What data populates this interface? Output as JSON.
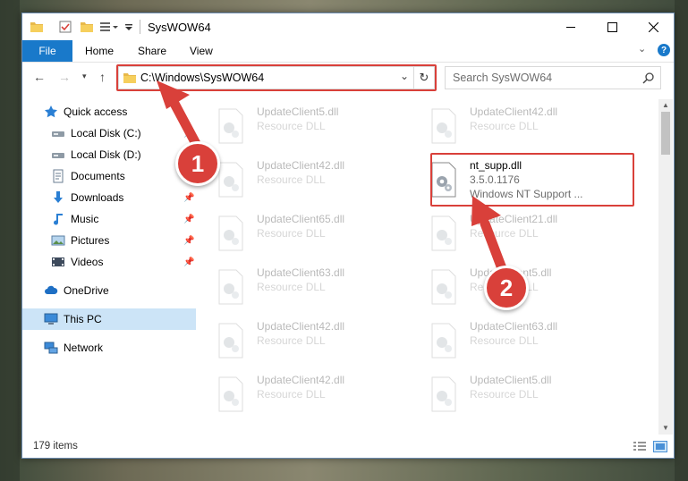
{
  "window": {
    "title": "SysWOW64"
  },
  "ribbon": {
    "tabs": [
      "File",
      "Home",
      "Share",
      "View"
    ],
    "help_label": "?"
  },
  "address": {
    "path": "C:\\Windows\\SysWOW64"
  },
  "search": {
    "placeholder": "Search SysWOW64"
  },
  "sidebar": {
    "items": [
      {
        "label": "Quick access",
        "icon": "star-icon"
      },
      {
        "label": "Local Disk (C:)",
        "icon": "drive-icon"
      },
      {
        "label": "Local Disk (D:)",
        "icon": "drive-icon"
      },
      {
        "label": "Documents",
        "icon": "documents-icon"
      },
      {
        "label": "Downloads",
        "icon": "downloads-icon"
      },
      {
        "label": "Music",
        "icon": "music-icon"
      },
      {
        "label": "Pictures",
        "icon": "pictures-icon"
      },
      {
        "label": "Videos",
        "icon": "videos-icon"
      },
      {
        "label": "OneDrive",
        "icon": "cloud-icon"
      },
      {
        "label": "This PC",
        "icon": "computer-icon"
      },
      {
        "label": "Network",
        "icon": "network-icon"
      }
    ]
  },
  "files": {
    "left": [
      {
        "name": "UpdateClient5.dll",
        "desc": "Resource DLL"
      },
      {
        "name": "UpdateClient42.dll",
        "desc": "Resource DLL"
      },
      {
        "name": "UpdateClient65.dll",
        "desc": "Resource DLL"
      },
      {
        "name": "UpdateClient63.dll",
        "desc": "Resource DLL"
      },
      {
        "name": "UpdateClient42.dll",
        "desc": "Resource DLL"
      },
      {
        "name": "UpdateClient42.dll",
        "desc": "Resource DLL"
      }
    ],
    "right": [
      {
        "name": "UpdateClient42.dll",
        "desc": "Resource DLL"
      },
      {
        "name": "UpdateClient21.dll",
        "desc": "Resource DLL"
      },
      {
        "name": "UpdateClient5.dll",
        "desc": "Resource DLL"
      },
      {
        "name": "UpdateClient63.dll",
        "desc": "Resource DLL"
      },
      {
        "name": "UpdateClient5.dll",
        "desc": "Resource DLL"
      }
    ],
    "highlighted": {
      "name": "nt_supp.dll",
      "version": "3.5.0.1176",
      "desc": "Windows NT Support ..."
    }
  },
  "status": {
    "item_count": "179 items"
  },
  "annotations": {
    "step1": "1",
    "step2": "2",
    "accent_color": "#d9403a"
  }
}
